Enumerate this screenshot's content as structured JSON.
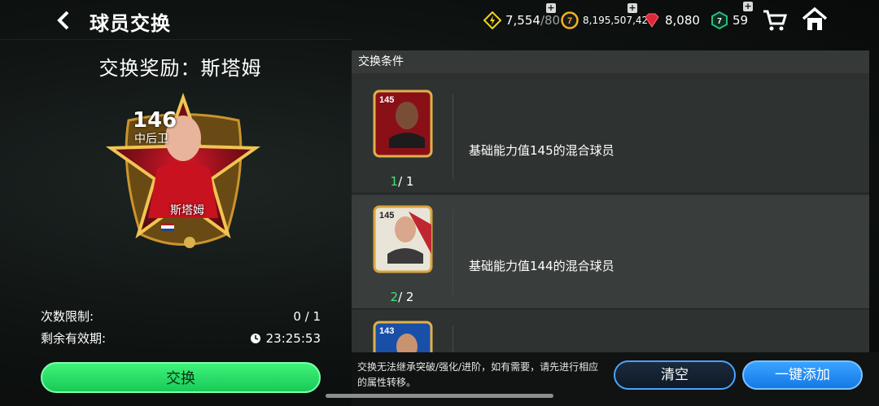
{
  "header": {
    "title": "球员交换",
    "currencies": [
      {
        "icon": "energy-icon",
        "value": "7,554",
        "max": "/80",
        "color": "#f5d31b"
      },
      {
        "icon": "coin-icon",
        "value": "8,195,507,423",
        "color": "#f3b21b"
      },
      {
        "icon": "gem-icon",
        "value": "8,080",
        "color": "#e0263a"
      },
      {
        "icon": "token-icon",
        "value": "59",
        "color": "#22c07a"
      }
    ]
  },
  "reward": {
    "title": "交换奖励：斯塔姆",
    "card": {
      "rating": "146",
      "position": "中后卫",
      "name": "斯塔姆"
    },
    "limit_label": "次数限制:",
    "limit_value": "0 / 1",
    "remaining_label": "剩余有效期:",
    "remaining_value": "23:25:53",
    "exchange_label": "交换"
  },
  "conditions": {
    "header": "交换条件",
    "rows": [
      {
        "thumb_rating": "145",
        "done": "1",
        "total": "/ 1",
        "text": "基础能力值145的混合球员"
      },
      {
        "thumb_rating": "145",
        "done": "2",
        "total": "/ 2",
        "text": "基础能力值144的混合球员"
      },
      {
        "thumb_rating": "143",
        "done": "",
        "total": "",
        "text": ""
      }
    ]
  },
  "footer": {
    "note": "交换无法继承突破/强化/进阶，如有需要，请先进行相应的属性转移。",
    "clear_label": "清空",
    "add_all_label": "一键添加"
  },
  "colors": {
    "accent_green": "#2ee36e",
    "accent_blue": "#1e8cff"
  }
}
